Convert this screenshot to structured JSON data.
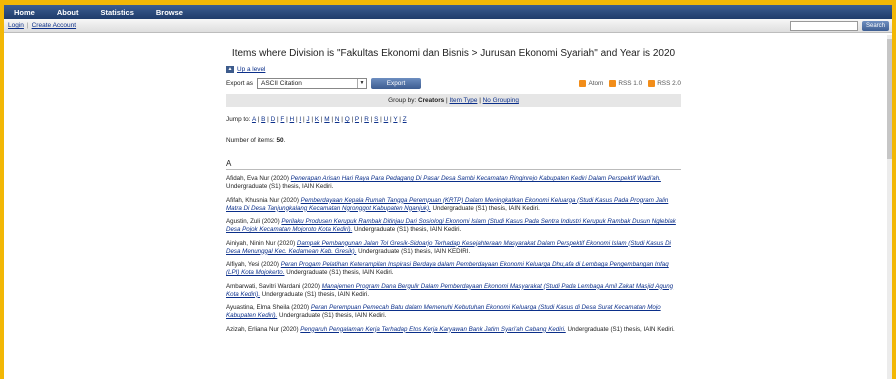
{
  "nav": {
    "items": [
      "Home",
      "About",
      "Statistics",
      "Browse"
    ]
  },
  "subbar": {
    "login": "Login",
    "create_account": "Create Account",
    "search_button": "Search",
    "search_value": ""
  },
  "page": {
    "title": "Items where Division is \"Fakultas Ekonomi dan Bisnis > Jurusan Ekonomi Syariah\" and Year is 2020",
    "up_level": "Up a level",
    "export_label": "Export as",
    "export_format": "ASCII Citation",
    "export_button": "Export",
    "feeds": [
      "Atom",
      "RSS 1.0",
      "RSS 2.0"
    ],
    "group_by_label": "Group by:",
    "group_current": "Creators",
    "group_item_type": "Item Type",
    "group_no_grouping": "No Grouping",
    "jump_label": "Jump to:",
    "letters": [
      "A",
      "B",
      "D",
      "F",
      "H",
      "I",
      "J",
      "K",
      "M",
      "N",
      "Q",
      "P",
      "R",
      "S",
      "U",
      "Y",
      "Z"
    ],
    "count_label": "Number of items:",
    "count_value": "50",
    "section": "A"
  },
  "entries": [
    {
      "author": "Afidah, Eva Nur (2020)",
      "title": "Penerapan Arisan Hari Raya Para Pedagang Di Pasar Desa Sambi Kecamatan Ringinrejo Kabupaten Kediri Dalam Perspektif Wadi'ah.",
      "rest": " Undergraduate (S1) thesis, IAIN Kediri."
    },
    {
      "author": "Afifah, Khusnia Nur (2020)",
      "title": "Pemberdayaan Kepala Rumah Tangga Perempuan (KRTP) Dalam Meningkatkan Ekonomi Keluarga (Studi Kasus Pada Program Jalin Matra Di Desa Tanjungkalang Kecamatan Ngronggot Kabupaten Nganjuk).",
      "rest": " Undergraduate (S1) thesis, IAIN Kediri."
    },
    {
      "author": "Agustin, Zuli (2020)",
      "title": "Perilaku Produsen Kerupuk Rambak Ditinjau Dari Sosiologi Ekonomi Islam (Studi Kasus Pada Sentra Industri Kerupuk Rambak Dusun Ngleblak Desa Pojok Kecamatan Mojoroto Kota Kediri).",
      "rest": " Undergraduate (S1) thesis, IAIN Kediri."
    },
    {
      "author": "Ainiyah, Ninin Nur (2020)",
      "title": "Dampak Pembangunan Jalan Tol Gresik-Sidoarjo Terhadap Kesejahteraan Masyarakat Dalam Perspektif Ekonomi Islam (Studi Kasus Di Desa Menunggal Kec. Kedamean Kab. Gresik).",
      "rest": " Undergraduate (S1) thesis, IAIN KEDIRI."
    },
    {
      "author": "Alfiyah, Yesi (2020)",
      "title": "Peran Progam Pelatihan Keterampilan Inspirasi Berdaya dalam Pemberdayaan Ekonomi Keluarga Dhu,afa di Lembaga Pengembangan Infaq (LPI) Kota Mojokerto.",
      "rest": " Undergraduate (S1) thesis, IAIN Kediri."
    },
    {
      "author": "Ambarwati, Savitri Wardani (2020)",
      "title": "Manajemen Program Dana Bergulir Dalam Pemberdayaan Ekonomi Masyarakat (Studi Pada Lembaga Amil Zakat Masjid Agung Kota Kediri).",
      "rest": " Undergraduate (S1) thesis, IAIN Kediri."
    },
    {
      "author": "Ayuastina, Elma Sheila (2020)",
      "title": "Peran Perempuan Pemecah Batu dalam Memenuhi Kebutuhan Ekonomi Keluarga (Studi Kasus di Desa Surat Kecamatan Mojo Kabupaten Kediri).",
      "rest": " Undergraduate (S1) thesis, IAIN Kediri."
    },
    {
      "author": "Azizah, Erliana Nur (2020)",
      "title": "Pengaruh Pengalaman Kerja Terhadap Etos Kerja Karyawan Bank Jatim Syari'ah Cabang Kediri.",
      "rest": " Undergraduate (S1) thesis, IAIN Kediri."
    }
  ]
}
